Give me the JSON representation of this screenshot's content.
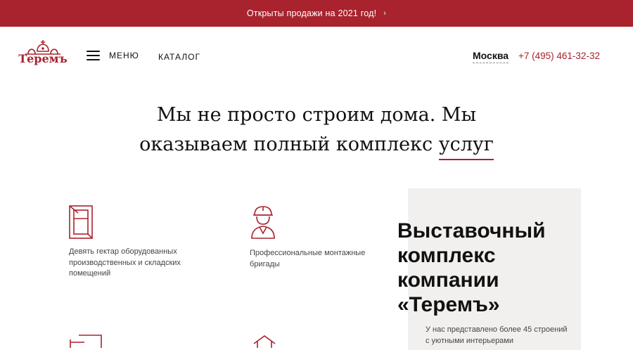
{
  "promo": {
    "text": "Открыты продажи на 2021 год!",
    "chevron": "›"
  },
  "header": {
    "logo_text": "Теремъ",
    "menu_label": "МЕНЮ",
    "catalog_label": "КАТАЛОГ",
    "city": "Москва",
    "phone": "+7 (495) 461-32-32"
  },
  "headline": {
    "line1": "Мы не просто строим дома. Мы",
    "line2_main": "оказываем полный комплекс ",
    "line2_underlined": "услуг"
  },
  "features": [
    {
      "icon": "window-icon",
      "text": "Девять гектар оборудованных производственных и складских помещений"
    },
    {
      "icon": "builder-icon",
      "text": "Профессиональные монтажные бригады"
    }
  ],
  "expo": {
    "title": "Выставочный комплекс компании «Теремъ»",
    "text": "У нас представлено более 45 строений с уютными интерьерами"
  },
  "colors": {
    "brand": "#a8232d",
    "panel": "#f1f0ee"
  }
}
